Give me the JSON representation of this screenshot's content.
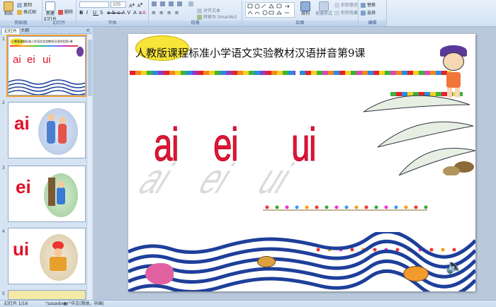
{
  "ribbon": {
    "clipboard": {
      "label": "剪贴板",
      "paste": "粘贴",
      "copy": "复制",
      "format_painter": "格式刷"
    },
    "slides": {
      "label": "幻灯片",
      "new_slide": "新建\n幻灯片",
      "delete": "删除"
    },
    "font": {
      "label": "字体",
      "size": "105"
    },
    "paragraph": {
      "label": "段落",
      "align_text": "对齐文本",
      "convert_smartart": "转换为 SmartArt"
    },
    "drawing": {
      "label": "绘图",
      "arrange": "排列",
      "quick_styles": "快速样式",
      "shape_fill": "形状填充",
      "shape_effects": "形状效果"
    },
    "editing": {
      "label": "编辑",
      "replace": "替换",
      "select": "选择"
    }
  },
  "leftpane": {
    "tab_slides": "幻灯片",
    "tab_outline": "大纲",
    "close": "×",
    "thumbs": [
      {
        "num": "1",
        "title": "人教版课程标准小学语文实验教材汉语拼音第9课",
        "syllables": [
          "ai",
          "ei",
          "ui"
        ]
      },
      {
        "num": "2",
        "syllable": "ai"
      },
      {
        "num": "3",
        "syllable": "ei"
      },
      {
        "num": "4",
        "syllable": "ui"
      },
      {
        "num": "5"
      }
    ]
  },
  "slide": {
    "title": "人教版课程标准小学语文实验教材汉语拼音第9课",
    "syllables": [
      "ai",
      "ei",
      "ui"
    ]
  },
  "statusbar": {
    "slide_indicator": "幻灯片 1/16",
    "theme": "\"sasadown\"",
    "language": "中文(简体，中国)"
  },
  "colors": {
    "syllable_red": "#e01636",
    "ribbon_blue": "#d3e2f4",
    "wave_blue": "#1e3f9a"
  }
}
